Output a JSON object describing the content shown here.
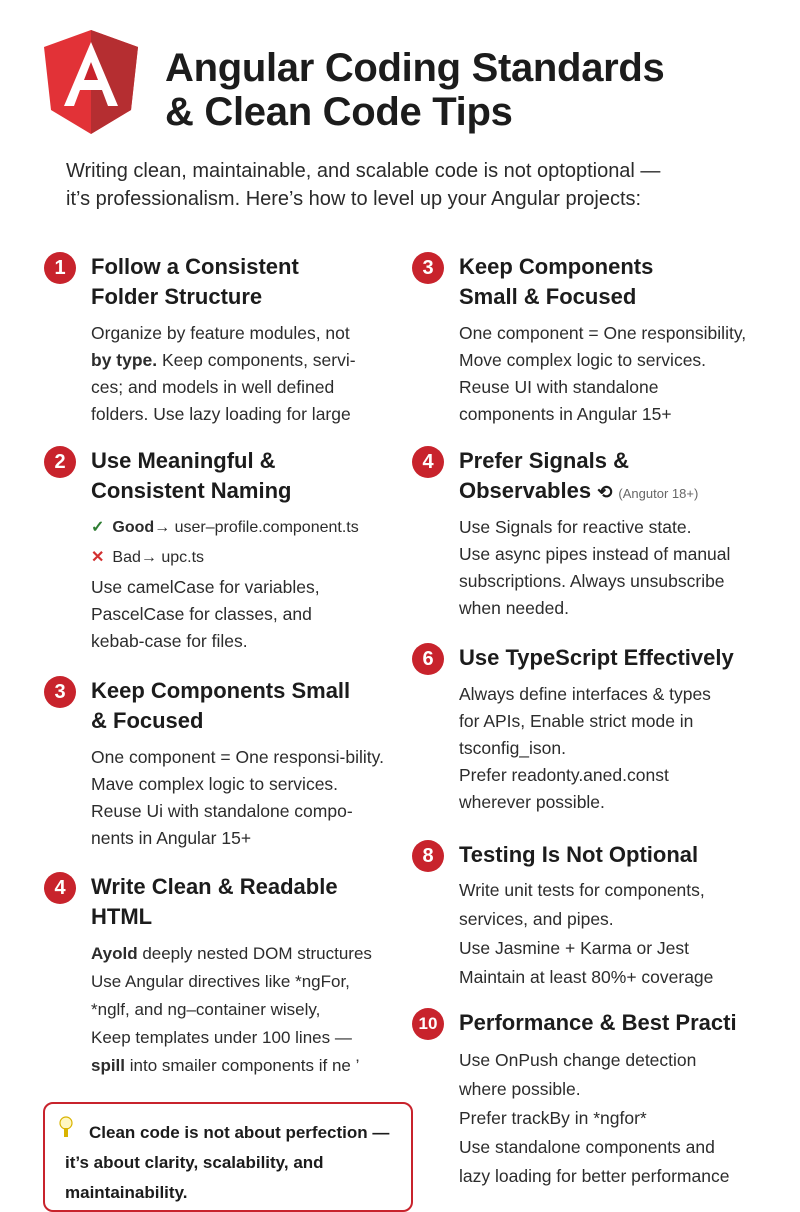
{
  "header": {
    "title_line1": "Angular Coding Standards",
    "title_line2": "& Clean Code Tips",
    "logo_letter": "A",
    "logo_colors": {
      "left": "#e23237",
      "right": "#b52e31"
    }
  },
  "intro": {
    "line1": "Writing clean, maintainable, and scalable code is not optoptional —",
    "line2": "it’s professionalism. Here’s how to level up your Angular projects:"
  },
  "left": [
    {
      "number": "1",
      "title_lines": [
        "Follow a Consistent",
        "Folder Structure"
      ],
      "body_lines": [
        {
          "prefix": "Organize by feature modules, not"
        },
        {
          "bold": "by type.",
          "rest": " Keep components, servi-"
        },
        {
          "prefix": "ces; and models in well defined"
        },
        {
          "prefix": "folders. Use lazy loading for large"
        }
      ]
    },
    {
      "number": "2",
      "title_lines": [
        "Use Meaningful &",
        "Consistent Naming"
      ],
      "good": {
        "label": "Good",
        "text": "→ user–profile.component.ts"
      },
      "bad": {
        "label": "Bad",
        "text": "→ upc.ts"
      },
      "body_lines": [
        {
          "prefix": "Use camelCase for variables,"
        },
        {
          "prefix": "PascelCase for classes, and"
        },
        {
          "prefix": "kebab-case for files."
        }
      ]
    },
    {
      "number": "3",
      "title_lines": [
        "Keep Components Small",
        "& Focused"
      ],
      "body_lines": [
        {
          "prefix": "One component =  One responsi-bility."
        },
        {
          "prefix": "Mave complex logic to services."
        },
        {
          "prefix": "Reuse Ui with standalone compo-"
        },
        {
          "prefix": "nents in Angular 15+"
        }
      ]
    },
    {
      "number": "4",
      "title_lines": [
        "Write Clean & Readable",
        "HTML"
      ],
      "body_lines": [
        {
          "bold": "Ayold",
          "rest": " deeply nested DOM structures"
        },
        {
          "prefix": "Use Angular directives like *ngFor,"
        },
        {
          "prefix": "*nglf, and ng–container wisely,"
        },
        {
          "prefix": "Keep templates under 100 lines —"
        },
        {
          "bold": "spill",
          "rest": " into smailer components if ne ’"
        }
      ]
    }
  ],
  "right": [
    {
      "number": "3",
      "title_lines": [
        "Keep Components",
        "Small & Focused"
      ],
      "body_lines": [
        "One component = One responsibility,",
        "Move complex logic to services.",
        "Reuse UI with standalone",
        "components in Angular 15+"
      ]
    },
    {
      "number": "4",
      "title_lines": [
        "Prefer Signals &",
        "Observables"
      ],
      "title_note": "(Angutor 18+)",
      "body_lines": [
        "Use Signals for reactive state.",
        "Use async pipes instead of manual",
        "subscriptions. Always unsubscribe",
        "when needed."
      ]
    },
    {
      "number": "6",
      "title_lines": [
        "Use TypeScript Effectively"
      ],
      "body_lines": [
        "Always define interfaces & types",
        "for APIs, Enable strict mode in",
        "tsconfig_ison.",
        "Prefer readonty.aned.const",
        "wherever possible."
      ]
    },
    {
      "number": "8",
      "title_lines": [
        "Testing Is Not Optional"
      ],
      "body_lines": [
        "Write unit tests for components,",
        "services, and pipes.",
        "Use Jasmine + Karma or Jest",
        "Maintain at least 80%+ coverage"
      ]
    },
    {
      "number": "10",
      "title_lines": [
        "Performance & Best Practi"
      ],
      "body_lines": [
        "Use OnPush change detection",
        "where possible.",
        "Prefer trackBy in *ngfor*",
        "Use standalone components and",
        "lazy loading for better performance"
      ]
    }
  ],
  "callout": {
    "line1": "Clean code is not about perfection —",
    "line2": "it’s about clarity, scalability, and",
    "line3": "maintainability."
  },
  "colors": {
    "accent": "#c8232c",
    "good": "#2e7d32",
    "bad": "#d32f2f"
  }
}
